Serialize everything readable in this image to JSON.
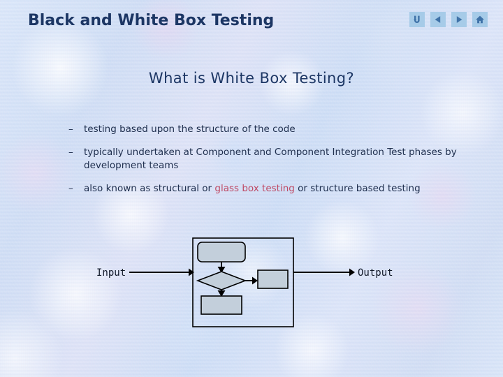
{
  "slide": {
    "title": "Black and White Box Testing",
    "heading": "What is White Box Testing?",
    "title_color": "#1c3664",
    "background_color": "#cfdff5"
  },
  "nav": {
    "buttons": [
      {
        "name": "return-icon",
        "label": "Return"
      },
      {
        "name": "previous-icon",
        "label": "Previous"
      },
      {
        "name": "next-icon",
        "label": "Next"
      },
      {
        "name": "home-icon",
        "label": "Home"
      }
    ],
    "button_color": "#a6cbe8",
    "glyph_color": "#3f72a8"
  },
  "bullets": {
    "dash": "–",
    "items": [
      {
        "parts": [
          {
            "text": "testing based upon the structure of the code",
            "highlight": false
          }
        ]
      },
      {
        "parts": [
          {
            "text": "typically undertaken at Component and Component Integration Test phases by development teams",
            "highlight": false
          }
        ]
      },
      {
        "parts": [
          {
            "text": "also known as structural or ",
            "highlight": false
          },
          {
            "text": "glass box testing",
            "highlight": true
          },
          {
            "text": " or structure based testing",
            "highlight": false
          }
        ]
      }
    ],
    "highlight_color": "#bf4a64",
    "text_color": "#20304f"
  },
  "diagram": {
    "input_label": "Input",
    "output_label": "Output",
    "shape_fill": "#c3cfdb",
    "stroke_color": "#000000",
    "shapes": [
      {
        "name": "process-rounded-rectangle",
        "type": "rounded-rect"
      },
      {
        "name": "decision-diamond",
        "type": "diamond"
      },
      {
        "name": "process-rectangle-right",
        "type": "rect"
      },
      {
        "name": "process-rectangle-bottom",
        "type": "rect"
      },
      {
        "name": "system-boundary-box",
        "type": "outline-rect"
      }
    ]
  }
}
